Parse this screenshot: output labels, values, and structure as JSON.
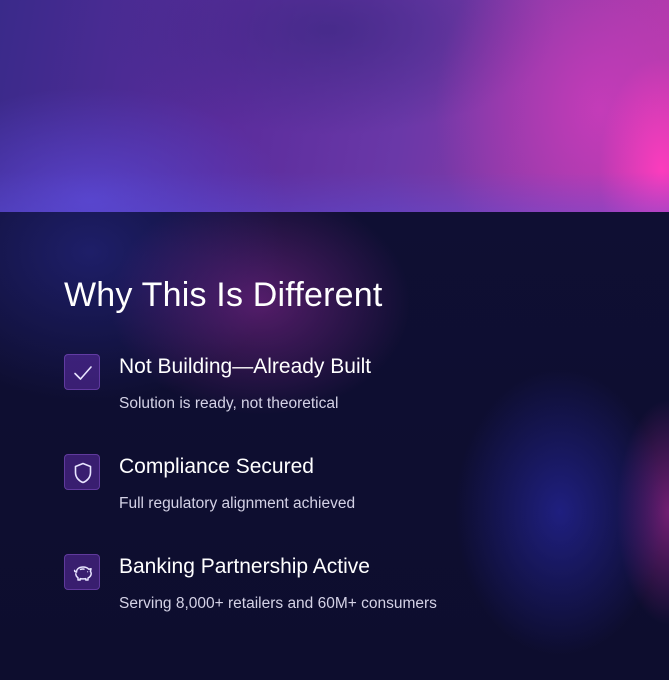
{
  "section": {
    "title": "Why This Is Different"
  },
  "features": [
    {
      "icon": "checkmark-icon",
      "heading": "Not Building—Already Built",
      "description": "Solution is ready, not theoretical"
    },
    {
      "icon": "shield-icon",
      "heading": "Compliance Secured",
      "description": "Full regulatory alignment achieved"
    },
    {
      "icon": "piggy-bank-icon",
      "heading": "Banking Partnership Active",
      "description": "Serving 8,000+ retailers and 60M+ consumers"
    }
  ],
  "colors": {
    "background": "#0d0d2e",
    "accent": "#7a3cc8",
    "text": "#ffffff",
    "muted_text": "#d4d2e6"
  }
}
